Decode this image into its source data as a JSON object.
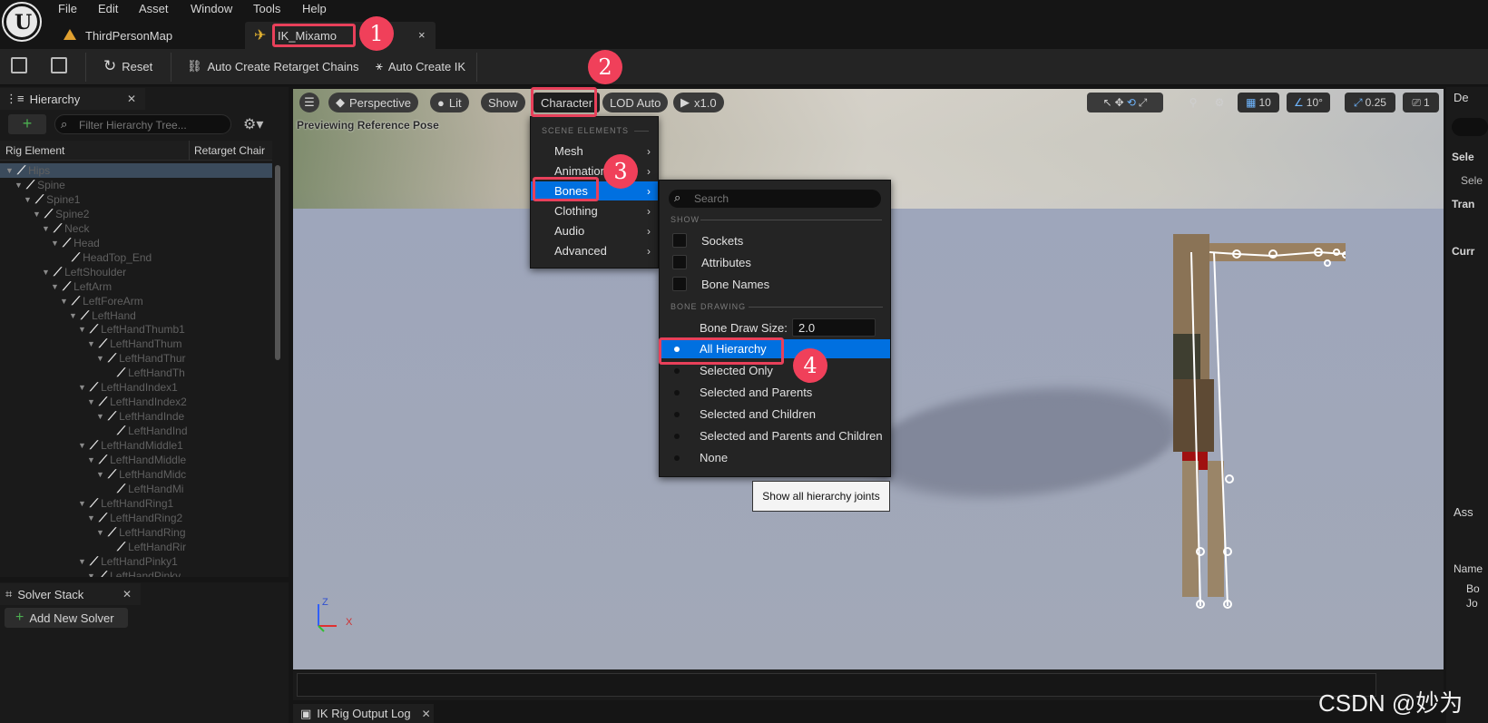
{
  "menu": [
    "File",
    "Edit",
    "Asset",
    "Window",
    "Tools",
    "Help"
  ],
  "tabs": {
    "map": "ThirdPersonMap",
    "asset": "IK_Mixamo",
    "close": "×"
  },
  "toolbar": {
    "reset": "Reset",
    "auto_chains": "Auto Create Retarget Chains",
    "auto_ik": "Auto Create IK"
  },
  "hierarchy": {
    "title": "Hierarchy",
    "search_placeholder": "Filter Hierarchy Tree...",
    "col_rig": "Rig Element",
    "col_chain": "Retarget Chair",
    "bones": [
      {
        "name": "Hips",
        "depth": 0,
        "arrow": true
      },
      {
        "name": "Spine",
        "depth": 1,
        "arrow": true
      },
      {
        "name": "Spine1",
        "depth": 2,
        "arrow": true
      },
      {
        "name": "Spine2",
        "depth": 3,
        "arrow": true
      },
      {
        "name": "Neck",
        "depth": 4,
        "arrow": true
      },
      {
        "name": "Head",
        "depth": 5,
        "arrow": true
      },
      {
        "name": "HeadTop_End",
        "depth": 6,
        "arrow": false
      },
      {
        "name": "LeftShoulder",
        "depth": 4,
        "arrow": true
      },
      {
        "name": "LeftArm",
        "depth": 5,
        "arrow": true
      },
      {
        "name": "LeftForeArm",
        "depth": 6,
        "arrow": true
      },
      {
        "name": "LeftHand",
        "depth": 7,
        "arrow": true
      },
      {
        "name": "LeftHandThumb1",
        "depth": 8,
        "arrow": true
      },
      {
        "name": "LeftHandThum",
        "depth": 9,
        "arrow": true
      },
      {
        "name": "LeftHandThur",
        "depth": 10,
        "arrow": true
      },
      {
        "name": "LeftHandTh",
        "depth": 11,
        "arrow": false
      },
      {
        "name": "LeftHandIndex1",
        "depth": 8,
        "arrow": true
      },
      {
        "name": "LeftHandIndex2",
        "depth": 9,
        "arrow": true
      },
      {
        "name": "LeftHandInde",
        "depth": 10,
        "arrow": true
      },
      {
        "name": "LeftHandInd",
        "depth": 11,
        "arrow": false
      },
      {
        "name": "LeftHandMiddle1",
        "depth": 8,
        "arrow": true
      },
      {
        "name": "LeftHandMiddle",
        "depth": 9,
        "arrow": true
      },
      {
        "name": "LeftHandMidc",
        "depth": 10,
        "arrow": true
      },
      {
        "name": "LeftHandMi",
        "depth": 11,
        "arrow": false
      },
      {
        "name": "LeftHandRing1",
        "depth": 8,
        "arrow": true
      },
      {
        "name": "LeftHandRing2",
        "depth": 9,
        "arrow": true
      },
      {
        "name": "LeftHandRing",
        "depth": 10,
        "arrow": true
      },
      {
        "name": "LeftHandRir",
        "depth": 11,
        "arrow": false
      },
      {
        "name": "LeftHandPinky1",
        "depth": 8,
        "arrow": true
      },
      {
        "name": "LeftHandPinky",
        "depth": 9,
        "arrow": true
      }
    ]
  },
  "solver": {
    "title": "Solver Stack",
    "add": "Add New Solver"
  },
  "viewport": {
    "perspective": "Perspective",
    "lit": "Lit",
    "show": "Show",
    "character": "Character",
    "lod": "LOD Auto",
    "speed": "x1.0",
    "preview": "Previewing Reference Pose",
    "grid": "10",
    "angle": "10°",
    "scale": "0.25",
    "camera": "1",
    "axis_z": "Z",
    "axis_x": "X"
  },
  "character_menu": {
    "section": "SCENE ELEMENTS",
    "items": [
      "Mesh",
      "Animation",
      "Bones",
      "Clothing",
      "Audio",
      "Advanced"
    ]
  },
  "bones_menu": {
    "search_placeholder": "Search",
    "show_section": "SHOW",
    "checks": [
      "Sockets",
      "Attributes",
      "Bone Names"
    ],
    "drawing_section": "BONE DRAWING",
    "draw_size_label": "Bone Draw Size:",
    "draw_size_value": "2.0",
    "options": [
      "All Hierarchy",
      "Selected Only",
      "Selected and Parents",
      "Selected and Children",
      "Selected and Parents and Children",
      "None"
    ],
    "tooltip": "Show all hierarchy joints"
  },
  "badges": [
    "1",
    "2",
    "3",
    "4"
  ],
  "right_panel": {
    "details": "De",
    "sele": "Sele",
    "sele2": "Sele",
    "tran": "Tran",
    "curr": "Curr",
    "assets": "Ass",
    "name_col": "Name",
    "item1": "Bo",
    "item2": "Jo"
  },
  "output_log": "IK Rig Output Log",
  "watermark": "CSDN @妙为",
  "colors": {
    "accent_blue": "#0070e0",
    "callout_red": "#e8405a",
    "panel_bg": "#1a1a1a"
  }
}
